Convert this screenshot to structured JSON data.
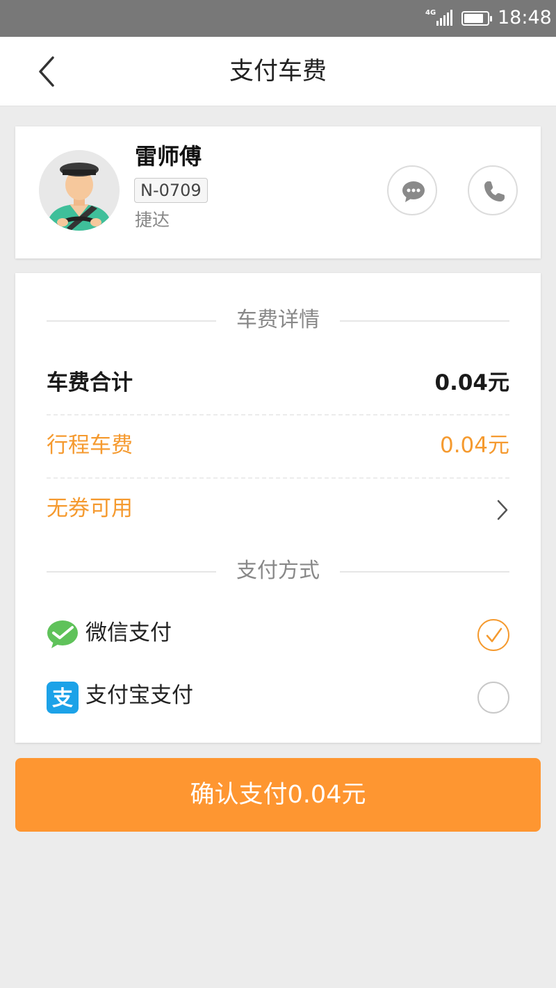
{
  "status_bar": {
    "network": "4G",
    "battery_level": 0.85,
    "time": "18:48"
  },
  "header": {
    "back_icon": "chevron-left-icon",
    "title": "支付车费"
  },
  "driver": {
    "name": "雷师傅",
    "plate": "N-0709",
    "car_model": "捷达",
    "message_icon": "chat-bubble-icon",
    "phone_icon": "phone-icon"
  },
  "fare": {
    "section_title": "车费详情",
    "total_label": "车费合计",
    "total_value": "0.04元",
    "trip_label": "行程车费",
    "trip_value": "0.04元",
    "coupon_label": "无券可用"
  },
  "payment": {
    "section_title": "支付方式",
    "methods": [
      {
        "label": "微信支付",
        "icon": "wechat-pay-icon",
        "selected": true
      },
      {
        "label": "支付宝支付",
        "icon": "alipay-icon",
        "selected": false
      }
    ]
  },
  "confirm_label": "确认支付0.04元",
  "colors": {
    "accent": "#fe9631",
    "fare_orange": "#f59a2f",
    "wechat_green": "#5fc25a",
    "alipay_blue": "#1ca2e8",
    "status_bar": "#787878",
    "page_bg": "#ececec"
  }
}
